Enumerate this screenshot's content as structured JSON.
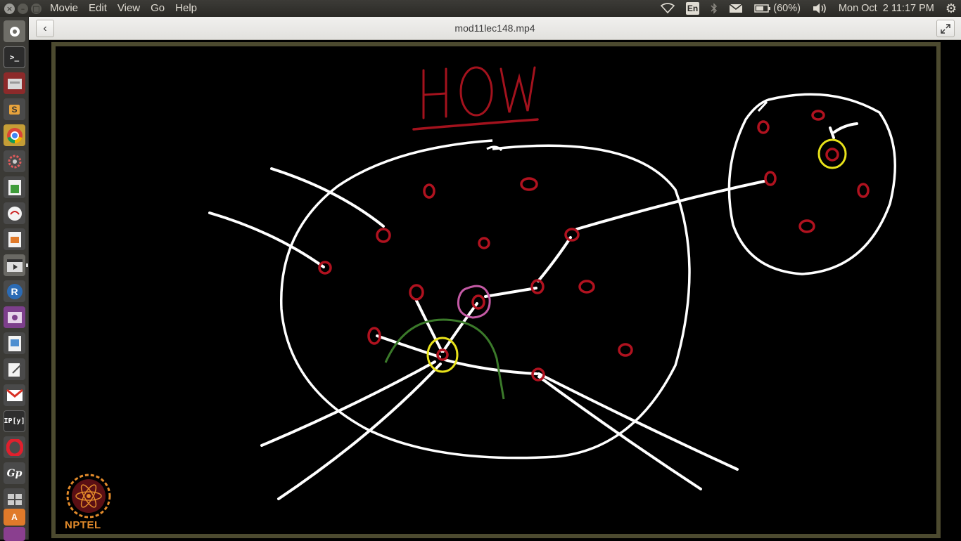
{
  "menubar": {
    "items": [
      "Movie",
      "Edit",
      "View",
      "Go",
      "Help"
    ],
    "window_buttons": [
      "close",
      "minimize",
      "maximize"
    ]
  },
  "indicators": {
    "wifi": "wifi-icon",
    "keyboard": "En̲",
    "bluetooth": "bluetooth-icon",
    "mail": "mail-icon",
    "battery": "(60%)",
    "volume": "volume-icon",
    "clock": "Mon Oct  2 11:17 PM",
    "system": "gear-icon"
  },
  "header": {
    "title": "mod11lec148.mp4",
    "back_icon": "chevron-left-icon",
    "fullscreen_icon": "expand-icon"
  },
  "launcher": {
    "apps": [
      "Search",
      "Terminal",
      "Files",
      "Sublime Text",
      "Chrome",
      "Settings",
      "Spreadsheet",
      "Ebook Reader",
      "Presentation",
      "Videos",
      "R",
      "Screen Recorder",
      "Document Viewer",
      "Text Editor",
      "Gmail",
      "IPython",
      "Opera",
      "Gnuplot",
      "Workspaces",
      "Software Center",
      "Documents"
    ]
  },
  "video": {
    "heading": "HOW",
    "logo_text": "NPTEL",
    "colors": {
      "chalk": "#ffffff",
      "node": "#b0121f",
      "heading": "#a3121d",
      "highlight_yellow": "#e8e21a",
      "highlight_pink": "#c45aa5",
      "arc_green": "#3b7a2a",
      "frame": "#4c4a2f"
    }
  }
}
